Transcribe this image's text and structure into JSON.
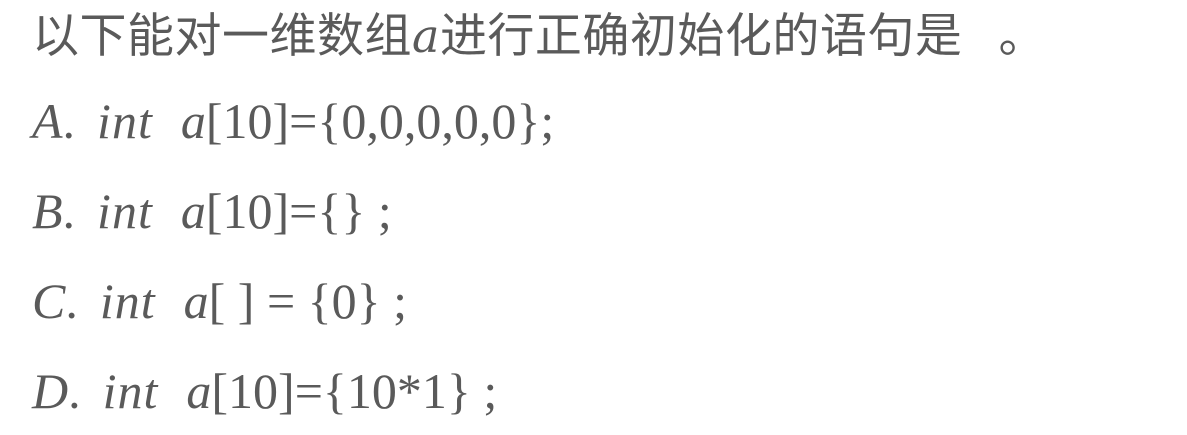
{
  "question": {
    "prefix": "以下能对一维数组",
    "var": "a",
    "suffix": "进行正确初始化的语句是",
    "end": "。"
  },
  "options": [
    {
      "letter": "A",
      "dot": ".",
      "keyword": "int",
      "ident": "a",
      "code": "[10]={0,0,0,0,0};"
    },
    {
      "letter": "B",
      "dot": ".",
      "keyword": "int",
      "ident": "a",
      "code": "[10]={} ;"
    },
    {
      "letter": "C",
      "dot": ".",
      "keyword": "int",
      "ident": "a",
      "code": "[ ] = {0} ;"
    },
    {
      "letter": "D",
      "dot": ".",
      "keyword": "int",
      "ident": "a",
      "code": "[10]={10*1} ;"
    }
  ]
}
